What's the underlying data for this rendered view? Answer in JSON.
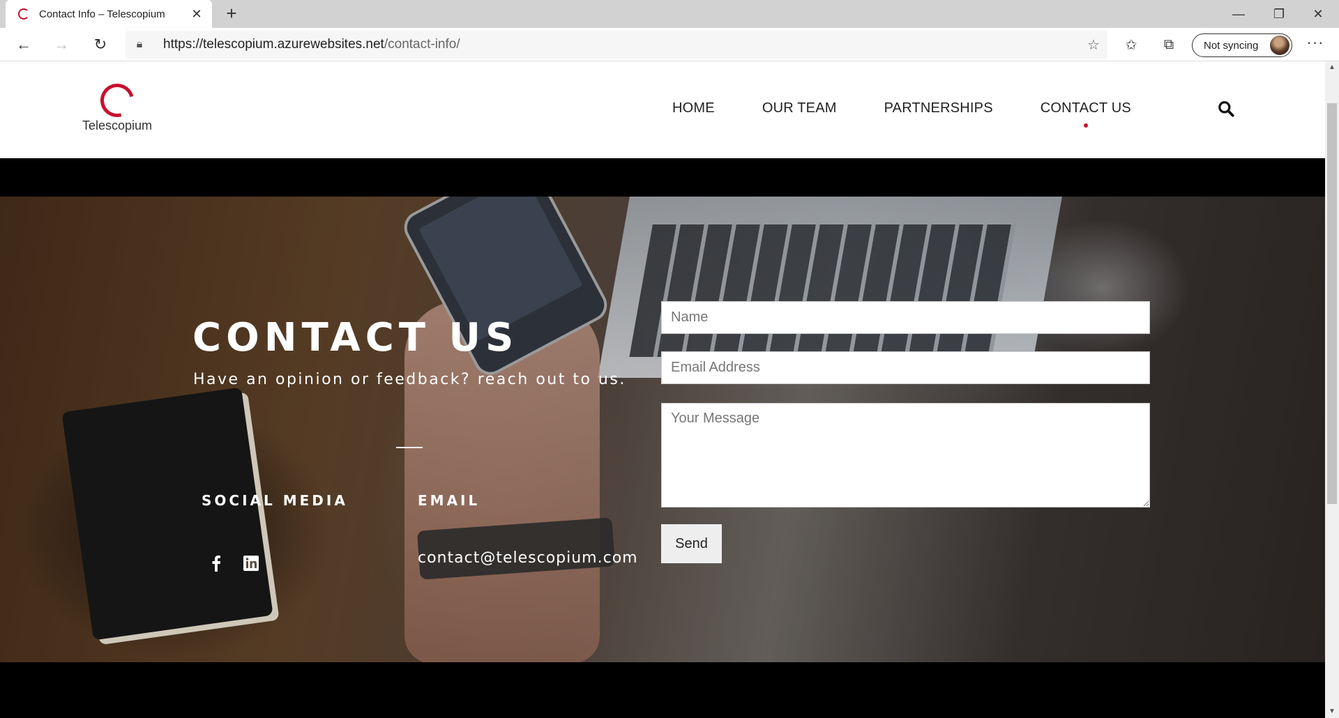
{
  "browser": {
    "tab_title": "Contact Info – Telescopium",
    "url_host": "https://telescopium.azurewebsites.net",
    "url_path": "/contact-info/",
    "sync_label": "Not syncing"
  },
  "site": {
    "logo_text": "Telescopium",
    "nav": [
      {
        "label": "HOME"
      },
      {
        "label": "OUR TEAM"
      },
      {
        "label": "PARTNERSHIPS"
      },
      {
        "label": "CONTACT US",
        "active": true
      }
    ],
    "accent_color": "#c8102e"
  },
  "hero": {
    "title": "CONTACT US",
    "subtitle": "Have an opinion or feedback? reach out to us.",
    "social_heading": "SOCIAL MEDIA",
    "email_heading": "EMAIL",
    "email": "contact@telescopium.com",
    "social_icons": [
      "facebook-icon",
      "linkedin-icon"
    ]
  },
  "form": {
    "name_placeholder": "Name",
    "email_placeholder": "Email Address",
    "message_placeholder": "Your Message",
    "send_label": "Send"
  }
}
